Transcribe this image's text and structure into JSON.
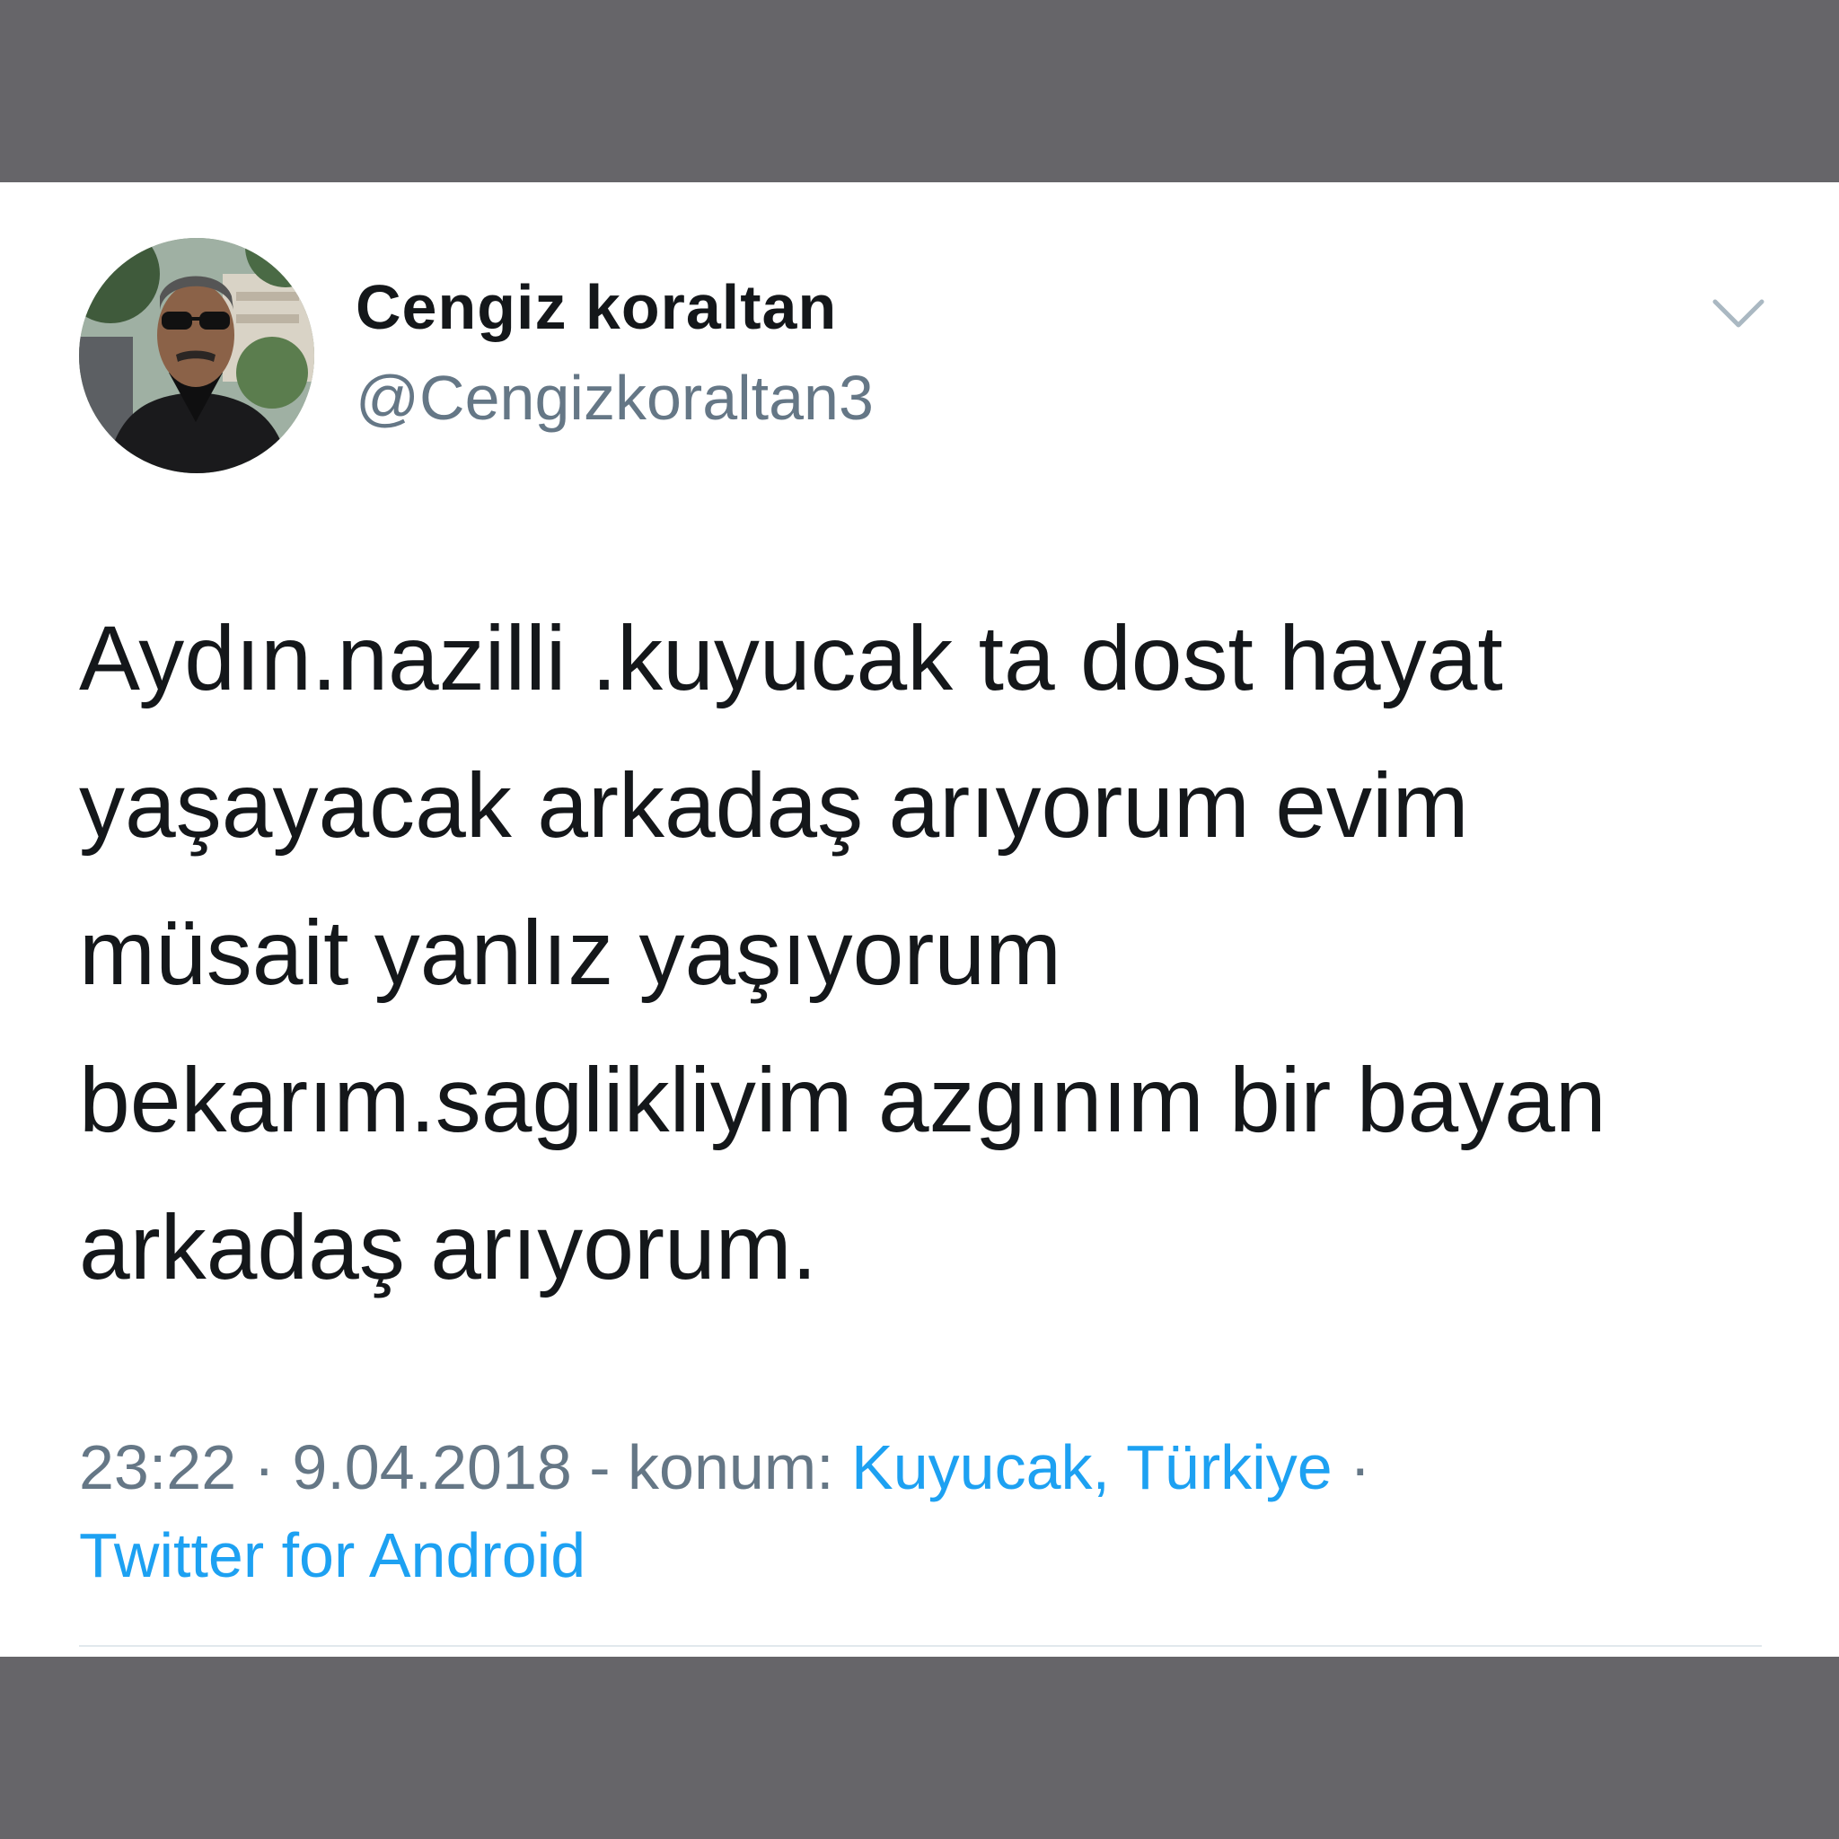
{
  "tweet": {
    "display_name": "Cengiz koraltan",
    "handle": "@Cengizkoraltan3",
    "text_lines": [
      "Aydın.nazilli .kuyucak ta dost hayat",
      "yaşayacak arkadaş arıyorum evim",
      "müsait yanlız yaşıyorum",
      "bekarım.saglikliyim azgınım bir bayan",
      "arkadaş arıyorum."
    ],
    "time": "23:22",
    "date": "9.04.2018",
    "location_prefix": "konum:",
    "location": "Kuyucak, Türkiye",
    "source": "Twitter for Android",
    "separator": "·",
    "dash": "-"
  },
  "icons": {
    "menu": "chevron-down-icon",
    "avatar": "profile-photo"
  },
  "colors": {
    "background_bars": "#666569",
    "card": "#ffffff",
    "text_primary": "#14171a",
    "text_secondary": "#657786",
    "link": "#1da1f2",
    "chevron": "#aab8c2",
    "divider": "#e1e8ed"
  }
}
